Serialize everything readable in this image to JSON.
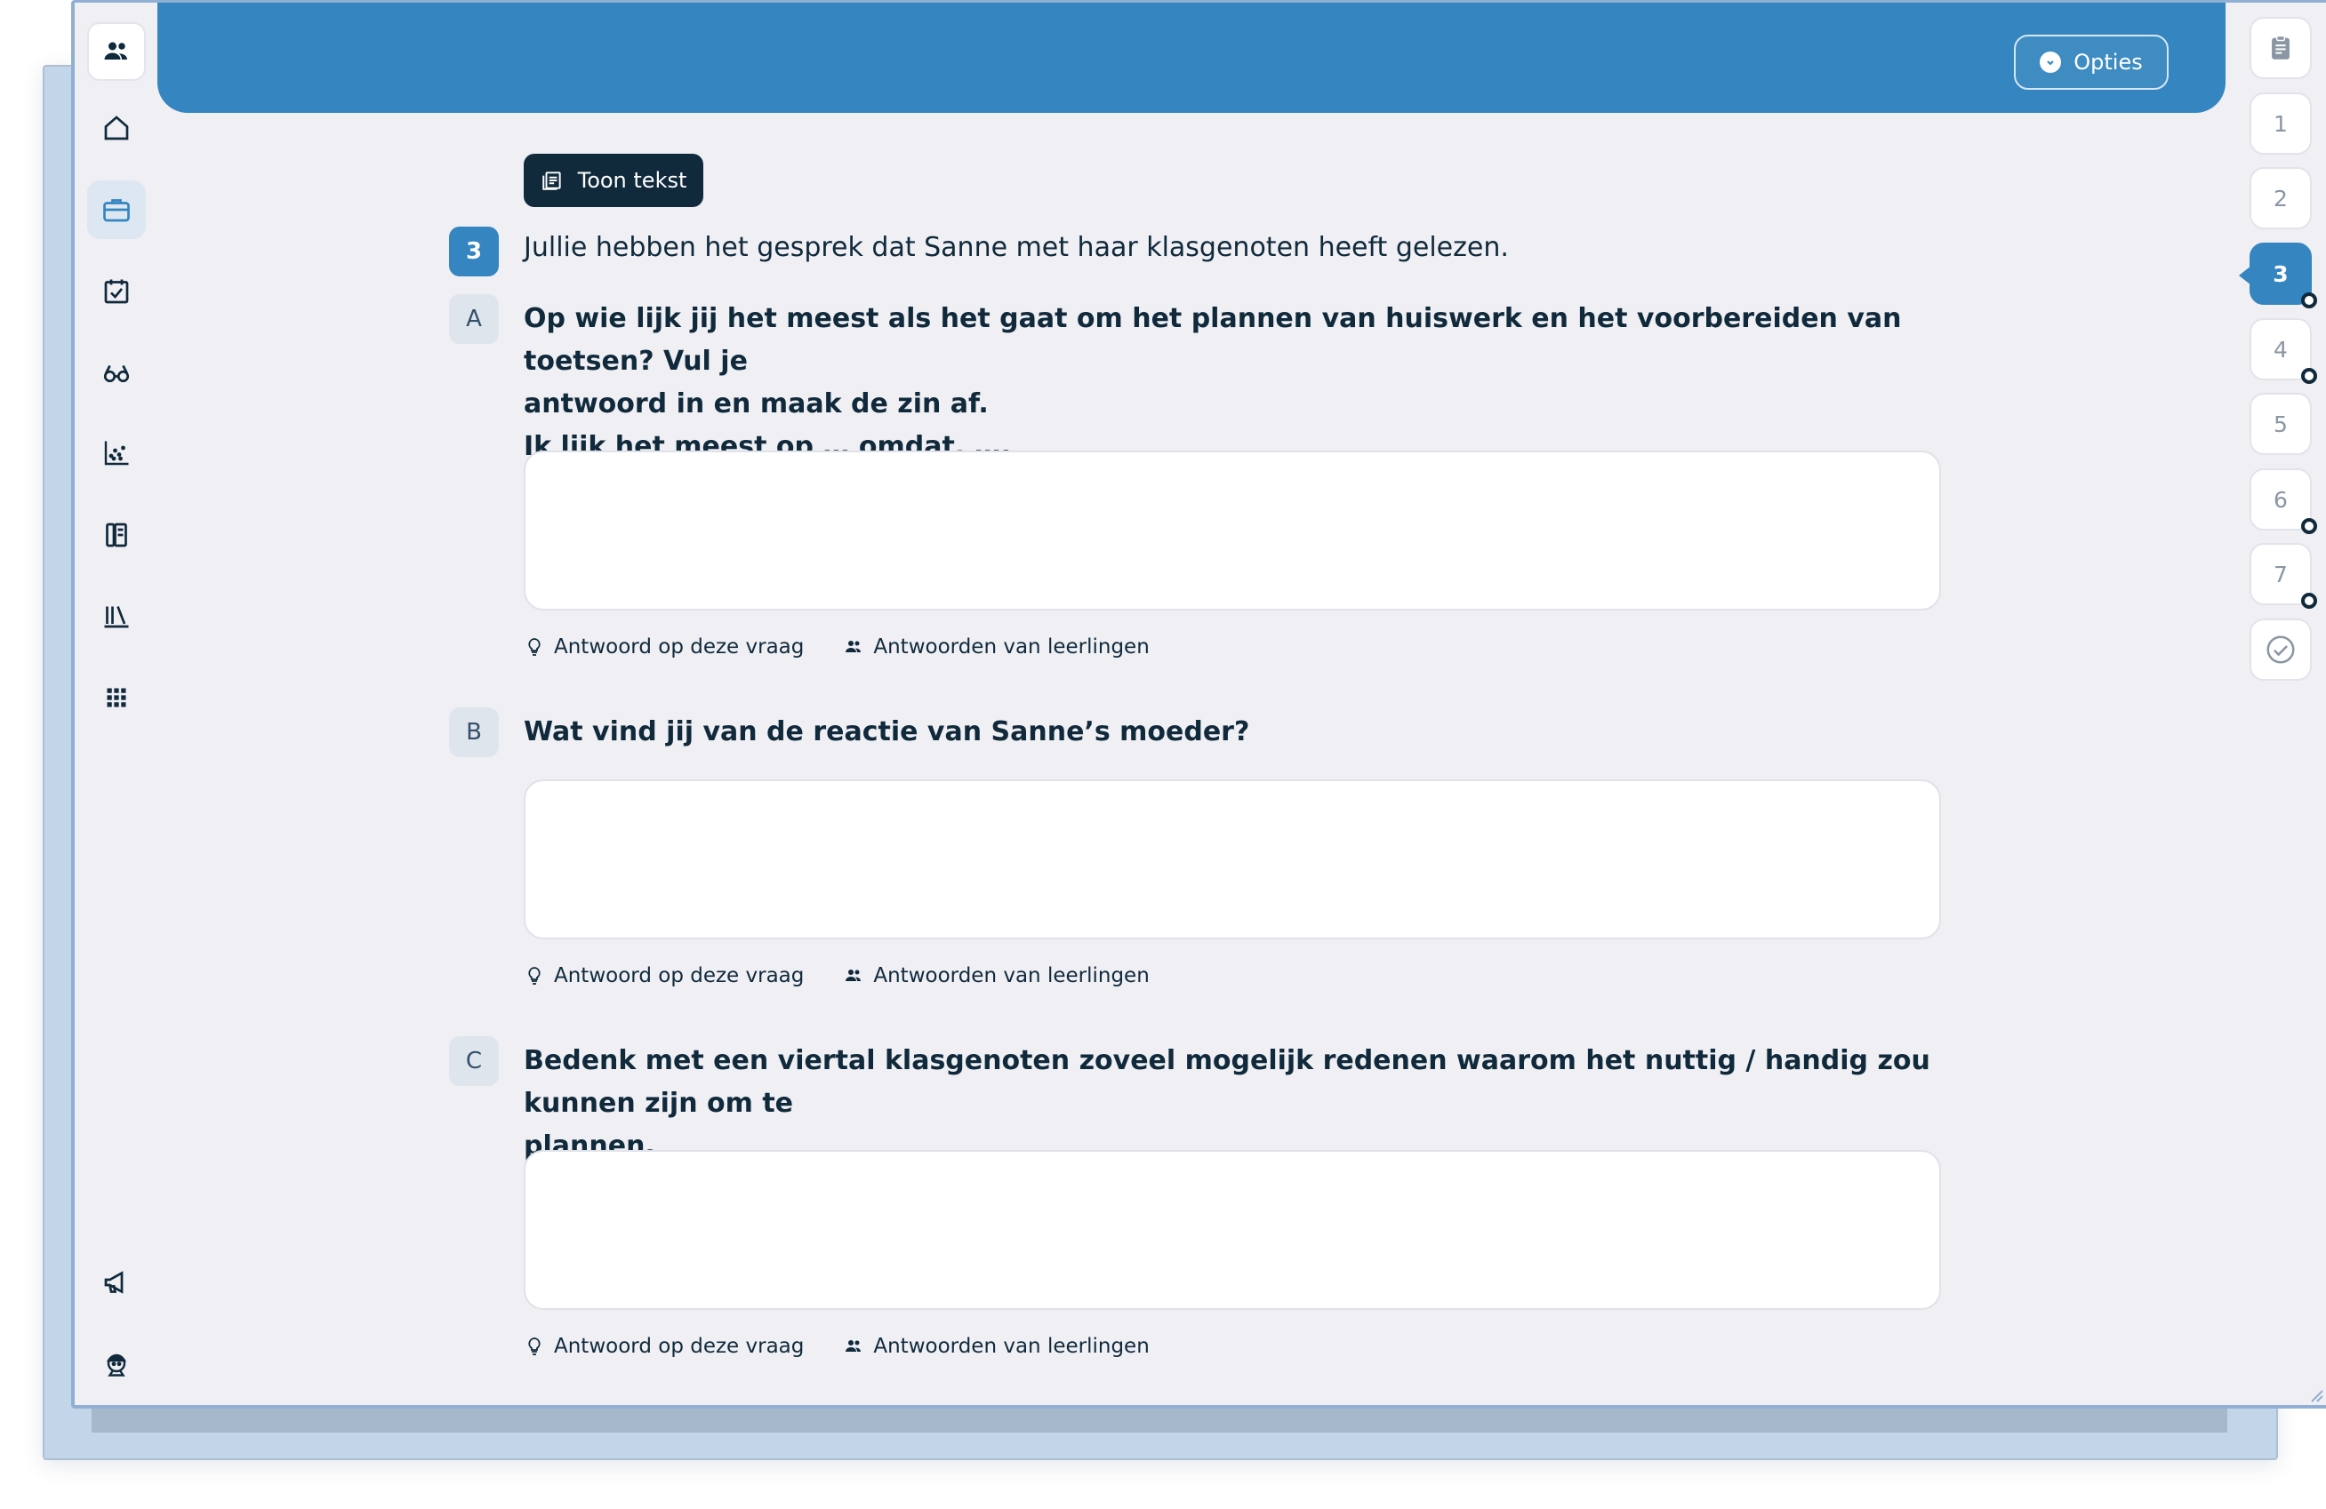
{
  "header": {
    "options_label": "Opties"
  },
  "sidebar": {
    "items": [
      {
        "name": "people-icon"
      },
      {
        "name": "home-icon"
      },
      {
        "name": "briefcase-icon"
      },
      {
        "name": "calendar-check-icon"
      },
      {
        "name": "glasses-icon"
      },
      {
        "name": "scatter-chart-icon"
      },
      {
        "name": "book-binder-icon"
      },
      {
        "name": "library-icon"
      },
      {
        "name": "apps-grid-icon"
      },
      {
        "name": "megaphone-icon"
      },
      {
        "name": "avatar-icon"
      }
    ]
  },
  "content": {
    "show_text_label": "Toon tekst",
    "exercise_number": "3",
    "intro": "Jullie hebben het gesprek dat Sanne met haar klasgenoten heeft gelezen.",
    "questions": [
      {
        "letter": "A",
        "line1": "Op wie lijk jij het meest als het gaat om het plannen van huiswerk en het voorbereiden van toetsen? Vul je",
        "line2": "antwoord in en maak de zin af.",
        "line3": "Ik lijk het meest op … omdat, ….",
        "answer_label": "Antwoord op deze vraag",
        "student_answers_label": "Antwoorden van leerlingen"
      },
      {
        "letter": "B",
        "line1": "Wat vind jij van de reactie van Sanne’s moeder?",
        "answer_label": "Antwoord op deze vraag",
        "student_answers_label": "Antwoorden van leerlingen"
      },
      {
        "letter": "C",
        "line1": "Bedenk met een viertal klasgenoten zoveel mogelijk redenen waarom het nuttig / handig zou kunnen zijn om te",
        "line2": "plannen.",
        "answer_label": "Antwoord op deze vraag",
        "student_answers_label": "Antwoorden van leerlingen"
      }
    ]
  },
  "rail": {
    "items": [
      {
        "label": "1",
        "marker": false
      },
      {
        "label": "2",
        "marker": false
      },
      {
        "label": "3",
        "marker": true,
        "active": true
      },
      {
        "label": "4",
        "marker": true
      },
      {
        "label": "5",
        "marker": false
      },
      {
        "label": "6",
        "marker": true
      },
      {
        "label": "7",
        "marker": true
      }
    ]
  },
  "colors": {
    "accent": "#3485c0",
    "dark": "#102a3c",
    "background": "#efeff4"
  }
}
